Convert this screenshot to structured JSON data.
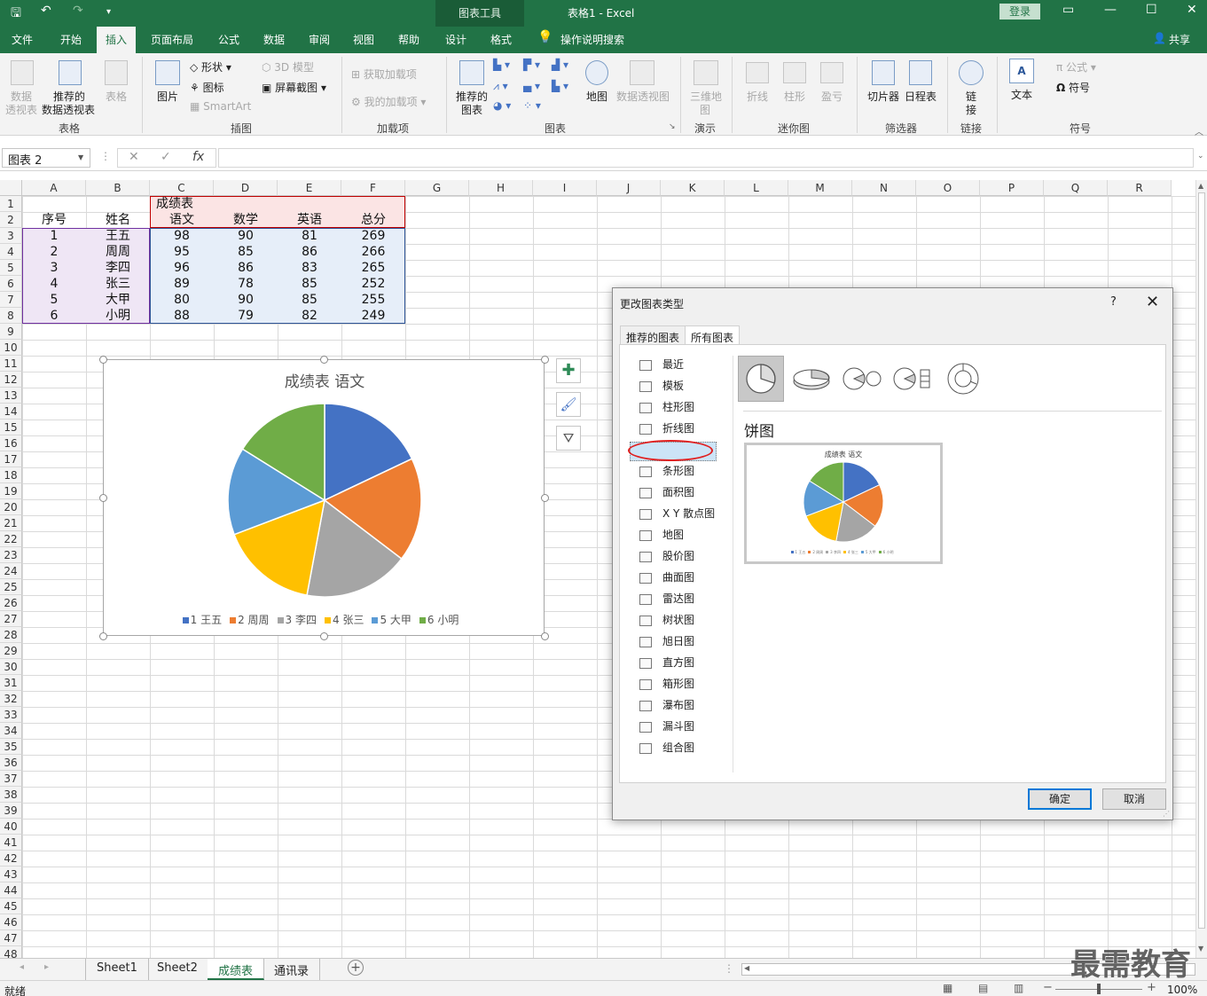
{
  "titlebar": {
    "chart_tools": "图表工具",
    "doc_title": "表格1  -  Excel",
    "login": "登录",
    "qa_save_icon": "save-icon",
    "qa_undo_icon": "undo-icon",
    "qa_redo_icon": "redo-icon"
  },
  "tabs": [
    "文件",
    "开始",
    "插入",
    "页面布局",
    "公式",
    "数据",
    "审阅",
    "视图",
    "帮助",
    "设计",
    "格式"
  ],
  "tell_me": "操作说明搜索",
  "share": "共享",
  "ribbon": {
    "pivot1": "数据",
    "pivot2": "透视表",
    "rec_pivot1": "推荐的",
    "rec_pivot2": "数据透视表",
    "table": "表格",
    "picture": "图片",
    "shapes": "形状",
    "icons": "图标",
    "smartart": "SmartArt",
    "model3d": "3D 模型",
    "screenshot": "屏幕截图",
    "get_addins": "获取加载项",
    "my_addins": "我的加载项",
    "rec_chart1": "推荐的",
    "rec_chart2": "图表",
    "map": "地图",
    "pivot_chart": "数据透视图",
    "map3d1": "三维地",
    "map3d2": "图",
    "spark_line": "折线",
    "spark_col": "柱形",
    "spark_wl": "盈亏",
    "slicer": "切片器",
    "timeline": "日程表",
    "link1": "链",
    "link2": "接",
    "text": "文本",
    "formula": "公式",
    "symbol": "符号",
    "groups": {
      "tables": "表格",
      "illustrations": "插图",
      "addins": "加载项",
      "charts": "图表",
      "tours": "演示",
      "sparklines": "迷你图",
      "filters": "筛选器",
      "links": "链接",
      "symbols": "符号"
    }
  },
  "formula_bar": {
    "name_box": "图表 2",
    "fx": "fx",
    "content": ""
  },
  "columns": [
    "A",
    "B",
    "C",
    "D",
    "E",
    "F",
    "G",
    "H",
    "I",
    "J",
    "K",
    "L",
    "M",
    "N",
    "O",
    "P",
    "Q",
    "R"
  ],
  "sheet": {
    "title": "成绩表",
    "headers": [
      "序号",
      "姓名",
      "语文",
      "数学",
      "英语",
      "总分"
    ],
    "rows": [
      [
        "1",
        "王五",
        "98",
        "90",
        "81",
        "269"
      ],
      [
        "2",
        "周周",
        "95",
        "85",
        "86",
        "266"
      ],
      [
        "3",
        "李四",
        "96",
        "86",
        "83",
        "265"
      ],
      [
        "4",
        "张三",
        "89",
        "78",
        "85",
        "252"
      ],
      [
        "5",
        "大甲",
        "80",
        "90",
        "85",
        "255"
      ],
      [
        "6",
        "小明",
        "88",
        "79",
        "82",
        "249"
      ]
    ]
  },
  "chart_data": {
    "type": "pie",
    "title": "成绩表 语文",
    "categories": [
      "1 王五",
      "2 周周",
      "3 李四",
      "4 张三",
      "5 大甲",
      "6 小明"
    ],
    "values": [
      98,
      95,
      96,
      89,
      80,
      88
    ],
    "colors": [
      "#4472c4",
      "#ed7d31",
      "#a5a5a5",
      "#ffc000",
      "#5b9bd5",
      "#70ad47"
    ],
    "legend": "bottom"
  },
  "chart_side_buttons": [
    "plus-icon",
    "brush-icon",
    "filter-icon"
  ],
  "dialog": {
    "title": "更改图表类型",
    "help": "?",
    "close": "✕",
    "tabs": [
      "推荐的图表",
      "所有图表"
    ],
    "types": [
      "最近",
      "模板",
      "柱形图",
      "折线图",
      "饼图",
      "条形图",
      "面积图",
      "X Y 散点图",
      "地图",
      "股价图",
      "曲面图",
      "雷达图",
      "树状图",
      "旭日图",
      "直方图",
      "箱形图",
      "瀑布图",
      "漏斗图",
      "组合图"
    ],
    "selected_type": "饼图",
    "section_label": "饼图",
    "preview_title": "成绩表 语文",
    "ok": "确定",
    "cancel": "取消"
  },
  "sheet_tabs": [
    "Sheet1",
    "Sheet2",
    "成绩表",
    "通讯录"
  ],
  "active_sheet": "成绩表",
  "status": {
    "ready": "就绪",
    "zoom": "100%"
  },
  "watermark": "最需教育"
}
